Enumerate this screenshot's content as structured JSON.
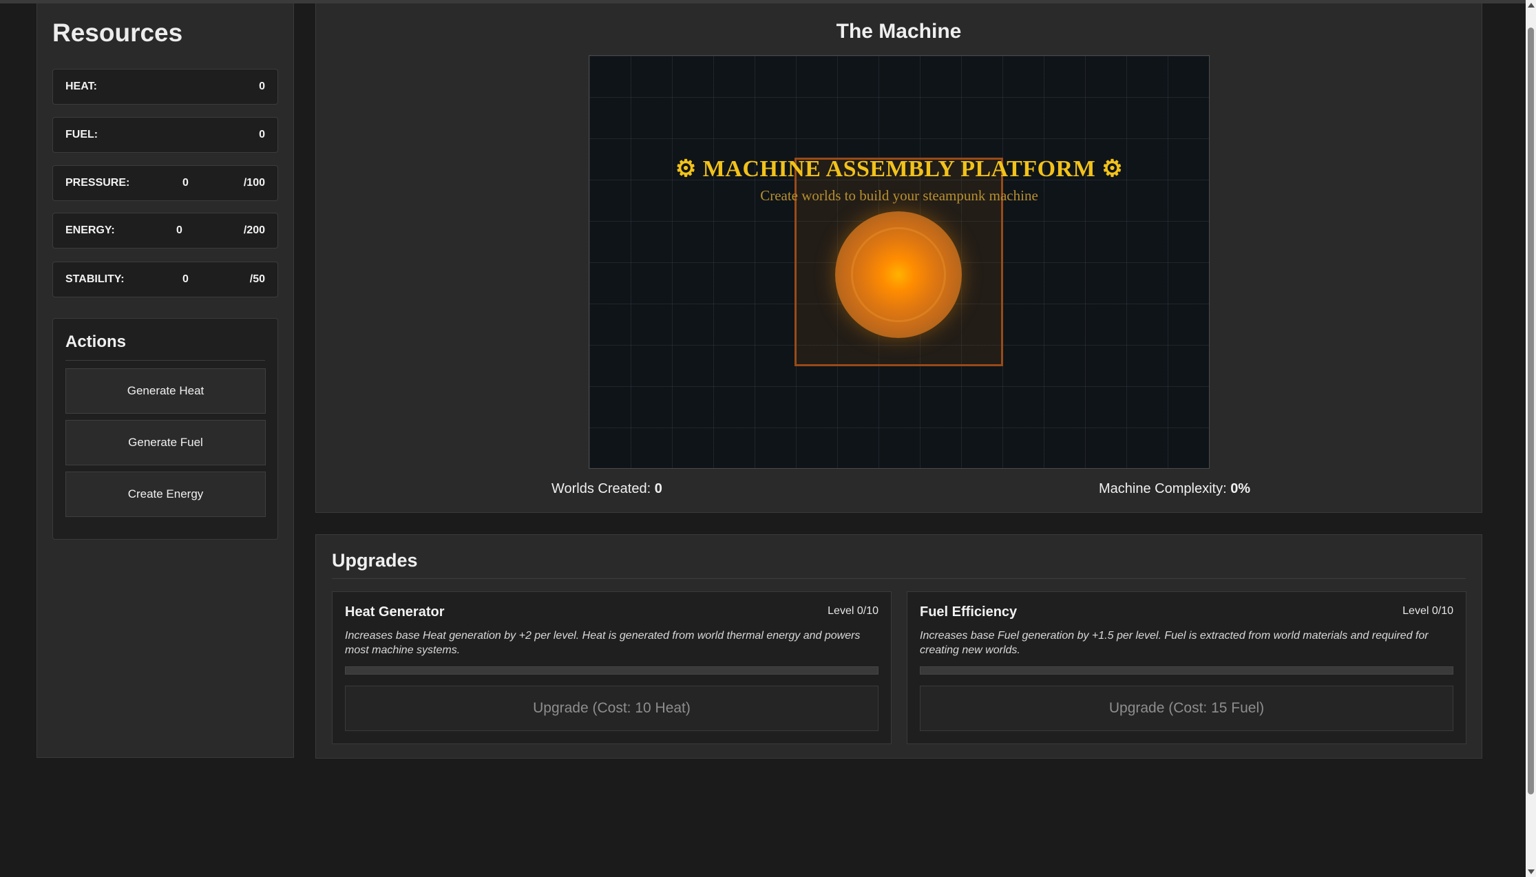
{
  "sidebar": {
    "title": "Resources",
    "resources": [
      {
        "label": "HEAT:",
        "value": "0",
        "max": ""
      },
      {
        "label": "FUEL:",
        "value": "0",
        "max": ""
      },
      {
        "label": "PRESSURE:",
        "value": "0",
        "max": "/100"
      },
      {
        "label": "ENERGY:",
        "value": "0",
        "max": "/200"
      },
      {
        "label": "STABILITY:",
        "value": "0",
        "max": "/50"
      }
    ],
    "actions": {
      "title": "Actions",
      "buttons": [
        "Generate Heat",
        "Generate Fuel",
        "Create Energy"
      ]
    }
  },
  "machine": {
    "title": "The Machine",
    "platform_title": "⚙ MACHINE ASSEMBLY PLATFORM ⚙",
    "platform_subtitle": "Create worlds to build your steampunk machine",
    "worlds_label": "Worlds Created:",
    "worlds_value": "0",
    "complexity_label": "Machine Complexity:",
    "complexity_value": "0%"
  },
  "upgrades": {
    "title": "Upgrades",
    "items": [
      {
        "name": "Heat Generator",
        "level": "Level 0/10",
        "description": "Increases base Heat generation by +2 per level. Heat is generated from world thermal energy and powers most machine systems.",
        "button": "Upgrade (Cost: 10 Heat)",
        "progress": 0
      },
      {
        "name": "Fuel Efficiency",
        "level": "Level 0/10",
        "description": "Increases base Fuel generation by +1.5 per level. Fuel is extracted from world materials and required for creating new worlds.",
        "button": "Upgrade (Cost: 15 Fuel)",
        "progress": 0
      }
    ]
  },
  "colors": {
    "accent_gold": "#f2c21a",
    "orb_orange": "#ff8c00",
    "frame_rust": "#9a4a18"
  }
}
